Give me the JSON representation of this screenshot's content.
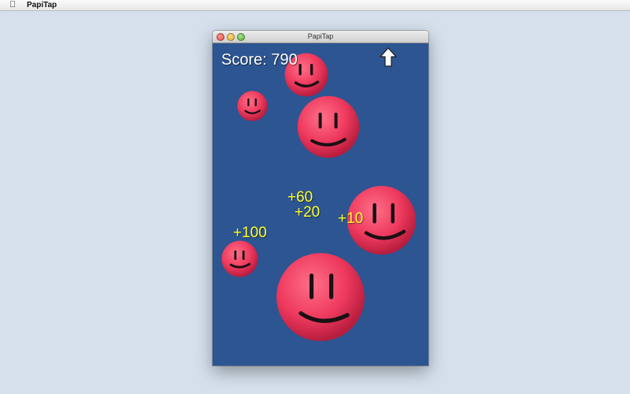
{
  "menubar": {
    "app_name": "PapiTap"
  },
  "window": {
    "title": "PapiTap"
  },
  "game": {
    "score_label": "Score: 790",
    "points": [
      "+60",
      "+20",
      "+10",
      "+100"
    ],
    "background_color": "#2c5592",
    "ball_color": "#f0385f",
    "points_color": "#ffff2a"
  },
  "icons": {
    "apple": "apple-icon",
    "up": "up-arrow-icon"
  }
}
